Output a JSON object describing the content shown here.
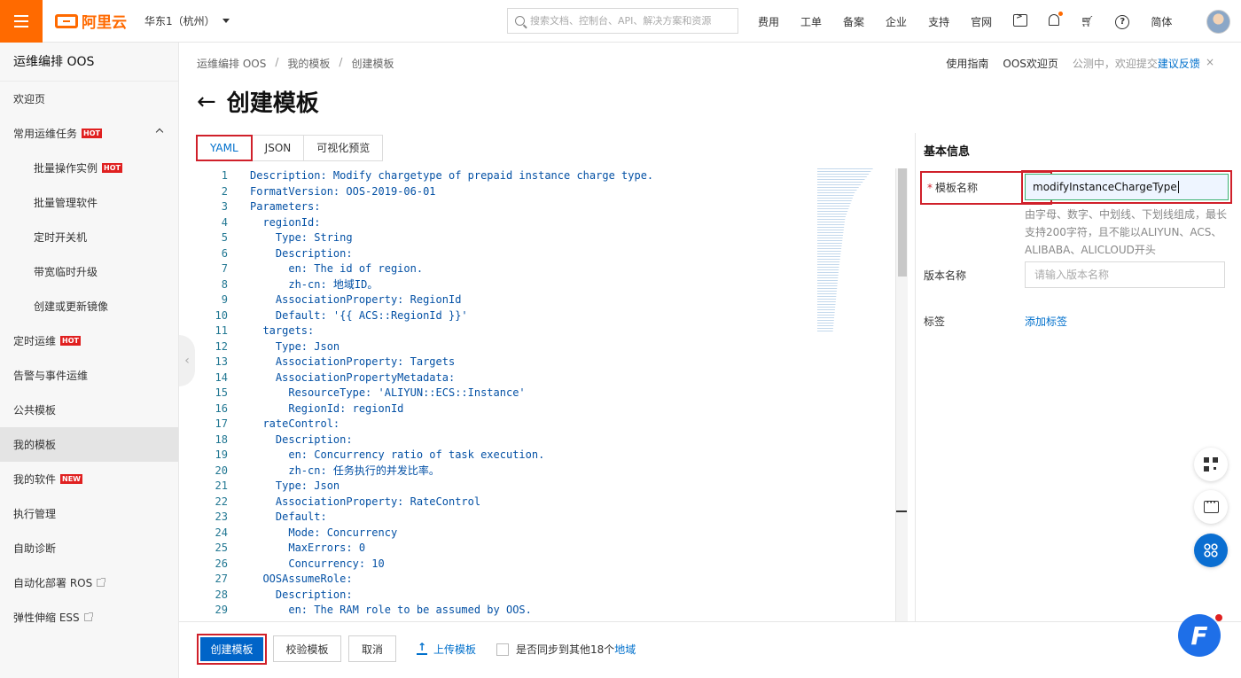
{
  "topbar": {
    "logo_text": "阿里云",
    "region": "华东1（杭州）",
    "search_placeholder": "搜索文档、控制台、API、解决方案和资源",
    "nav": [
      "费用",
      "工单",
      "备案",
      "企业",
      "支持",
      "官网"
    ],
    "language": "简体",
    "icons": [
      "terminal-icon",
      "bell-icon",
      "cart-icon",
      "help-icon"
    ],
    "accent_color": "#ff6a00"
  },
  "sidebar": {
    "title": "运维编排 OOS",
    "items": [
      {
        "label": "欢迎页"
      },
      {
        "label": "常用运维任务",
        "badge": "HOT",
        "expanded": true
      },
      {
        "label": "批量操作实例",
        "badge": "HOT",
        "sub": true
      },
      {
        "label": "批量管理软件",
        "sub": true
      },
      {
        "label": "定时开关机",
        "sub": true
      },
      {
        "label": "带宽临时升级",
        "sub": true
      },
      {
        "label": "创建或更新镜像",
        "sub": true
      },
      {
        "label": "定时运维",
        "badge": "HOT"
      },
      {
        "label": "告警与事件运维"
      },
      {
        "label": "公共模板"
      },
      {
        "label": "我的模板",
        "active": true
      },
      {
        "label": "我的软件",
        "badge": "NEW"
      },
      {
        "label": "执行管理"
      },
      {
        "label": "自助诊断"
      },
      {
        "label": "自动化部署 ROS",
        "external": true
      },
      {
        "label": "弹性伸缩 ESS",
        "external": true
      }
    ]
  },
  "breadcrumb": [
    "运维编排 OOS",
    "我的模板",
    "创建模板"
  ],
  "top_links": {
    "guide": "使用指南",
    "welcome": "OOS欢迎页",
    "beta_text": "公测中，欢迎提交",
    "feedback": "建议反馈",
    "close": "×"
  },
  "page_title": "创建模板",
  "tabs": [
    {
      "label": "YAML",
      "active": true
    },
    {
      "label": "JSON"
    },
    {
      "label": "可视化预览"
    }
  ],
  "editor": {
    "lines": [
      "Description: Modify chargetype of prepaid instance charge type.",
      "FormatVersion: OOS-2019-06-01",
      "Parameters:",
      "  regionId:",
      "    Type: String",
      "    Description:",
      "      en: The id of region.",
      "      zh-cn: 地域ID。",
      "    AssociationProperty: RegionId",
      "    Default: '{{ ACS::RegionId }}'",
      "  targets:",
      "    Type: Json",
      "    AssociationProperty: Targets",
      "    AssociationPropertyMetadata:",
      "      ResourceType: 'ALIYUN::ECS::Instance'",
      "      RegionId: regionId",
      "  rateControl:",
      "    Description:",
      "      en: Concurrency ratio of task execution.",
      "      zh-cn: 任务执行的并发比率。",
      "    Type: Json",
      "    AssociationProperty: RateControl",
      "    Default:",
      "      Mode: Concurrency",
      "      MaxErrors: 0",
      "      Concurrency: 10",
      "  OOSAssumeRole:",
      "    Description:",
      "      en: The RAM role to be assumed by OOS."
    ]
  },
  "basic_info": {
    "title": "基本信息",
    "name_label": "模板名称",
    "required_mark": "*",
    "name_value": "modifyInstanceChargeType",
    "name_hint": "由字母、数字、中划线、下划线组成，最长支持200字符，且不能以ALIYUN、ACS、ALIBABA、ALICLOUD开头",
    "version_label": "版本名称",
    "version_placeholder": "请输入版本名称",
    "tag_label": "标签",
    "add_tag": "添加标签"
  },
  "footer": {
    "create": "创建模板",
    "validate": "校验模板",
    "cancel": "取消",
    "upload": "上传模板",
    "sync_text": "是否同步到其他18个",
    "sync_link": "地域"
  }
}
